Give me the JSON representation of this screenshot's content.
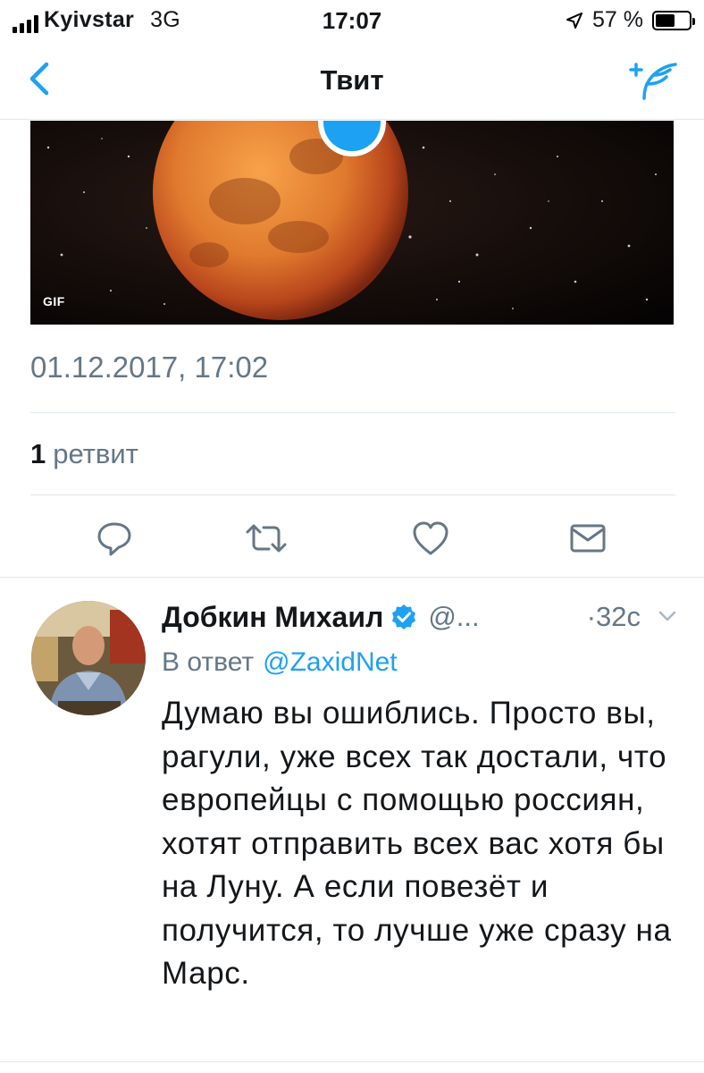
{
  "status_bar": {
    "carrier": "Kyivstar",
    "network": "3G",
    "time": "17:07",
    "battery_text": "57 %",
    "battery_level": 0.57
  },
  "nav": {
    "title": "Твит",
    "back_icon": "chevron-left-icon",
    "compose_icon": "compose-tweet-icon"
  },
  "media": {
    "badge": "GIF",
    "play_icon": "play-icon"
  },
  "tweet": {
    "timestamp": "01.12.2017, 17:02",
    "retweet_count": "1",
    "retweet_label": "ретвит"
  },
  "actions": [
    {
      "name": "reply",
      "icon": "reply-icon"
    },
    {
      "name": "retweet",
      "icon": "retweet-icon"
    },
    {
      "name": "like",
      "icon": "heart-icon"
    },
    {
      "name": "share",
      "icon": "mail-icon"
    }
  ],
  "reply": {
    "author": "Добкин Михаил",
    "handle": "@...",
    "time": "·32с",
    "reply_prefix": "В ответ",
    "reply_to": "@ZaxidNet",
    "text": "Думаю вы ошиблись. Просто вы, рагули, уже всех так достали, что европейцы с помощью россиян, хотят отправить всех вас хотя бы на Луну. А если повезёт и получится, то лучше уже сразу на Марс."
  },
  "colors": {
    "accent": "#1da1f2",
    "secondary_text": "#657786",
    "divider": "#e1e8ed"
  }
}
